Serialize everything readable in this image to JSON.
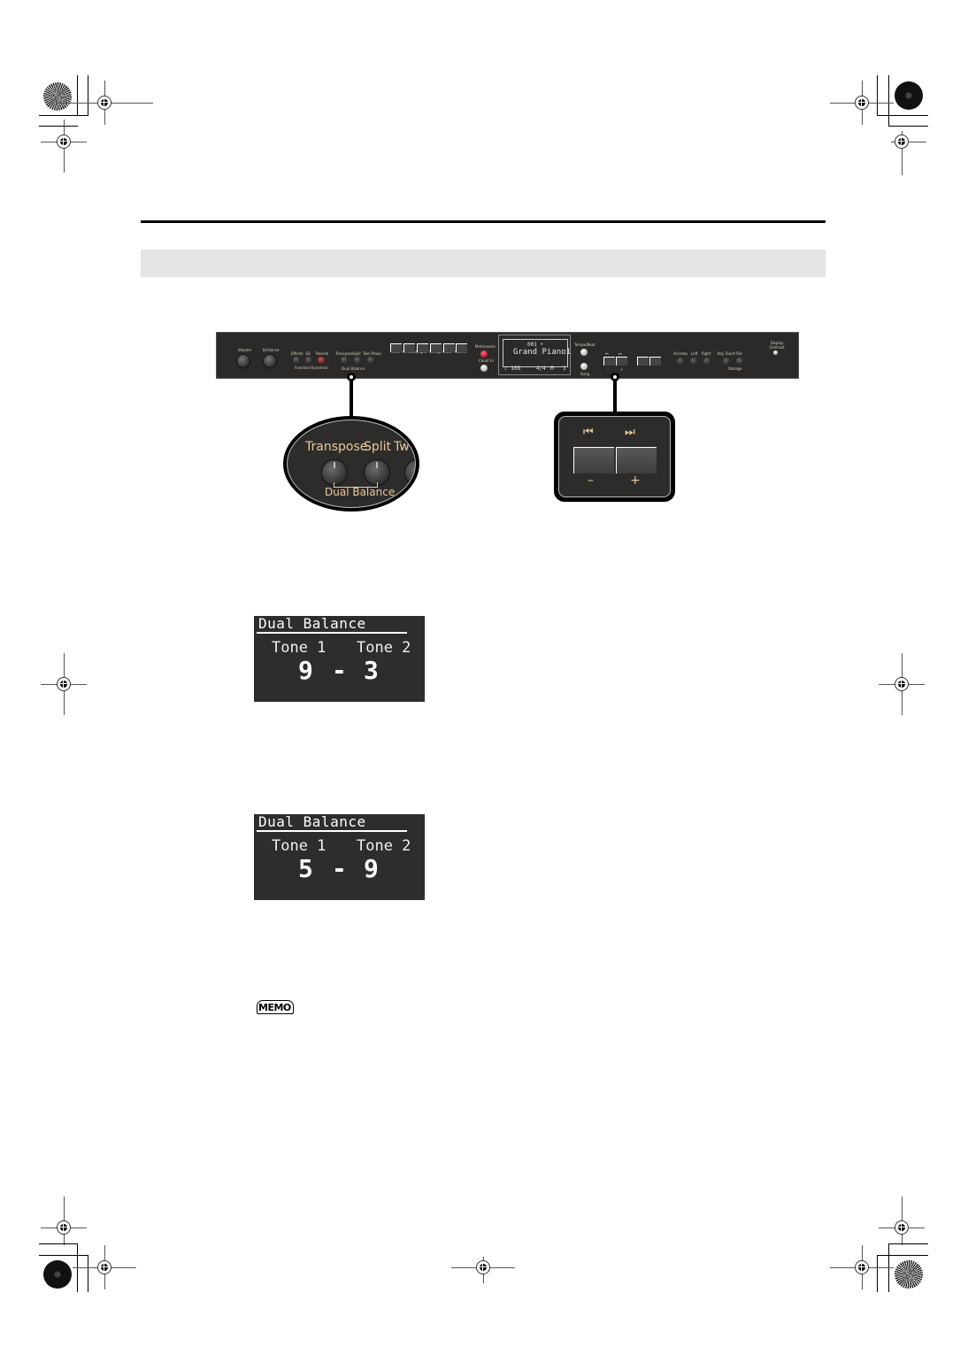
{
  "panel": {
    "labels": {
      "volume": "Volume",
      "brilliance": "Brilliance",
      "effects": "Effects",
      "three_d": "3D",
      "reverb": "Reverb",
      "function_dynamics": "Function  Dynamics",
      "transpose": "Transpose",
      "split": "Split",
      "twin_piano": "Twin Piano",
      "dual_balance": "Dual Balance",
      "tones": [
        "Piano",
        "E.Piano",
        "Organ",
        "Strings",
        "Voice",
        "Others"
      ],
      "metronome": "Metronome",
      "count_in": "Count In",
      "tempo_beat": "Tempo/Beat",
      "song": "Song",
      "minus": "–",
      "plus": "+",
      "accomp": "Accomp",
      "left": "Left",
      "right": "Right",
      "key_touch": "Key Touch",
      "file": "File",
      "storage": "Storage",
      "display_contrast": "Display Contrast"
    },
    "lcd": {
      "number": "001 •",
      "tone_name": "Grand Piano1",
      "tempo": "♪ 108",
      "beat": "4/4",
      "measure_label": "M",
      "measure": "1"
    },
    "accent_color": "#e6c99a"
  },
  "zoom_ellipse": {
    "transpose": "Transpose",
    "split": "Split",
    "twin_partial": "Tw",
    "dual_balance": "Dual Balance"
  },
  "zoom_rect": {
    "rewind_icon": "⏮",
    "forward_icon": "⏭",
    "minus": "–",
    "plus": "+"
  },
  "displays": [
    {
      "title": "Dual Balance",
      "tone1_label": "Tone 1",
      "tone2_label": "Tone 2",
      "tone1_value": "9",
      "separator": "-",
      "tone2_value": "3"
    },
    {
      "title": "Dual Balance",
      "tone1_label": "Tone 1",
      "tone2_label": "Tone 2",
      "tone1_value": "5",
      "separator": "-",
      "tone2_value": "9"
    }
  ],
  "memo": {
    "label": "MEMO"
  }
}
